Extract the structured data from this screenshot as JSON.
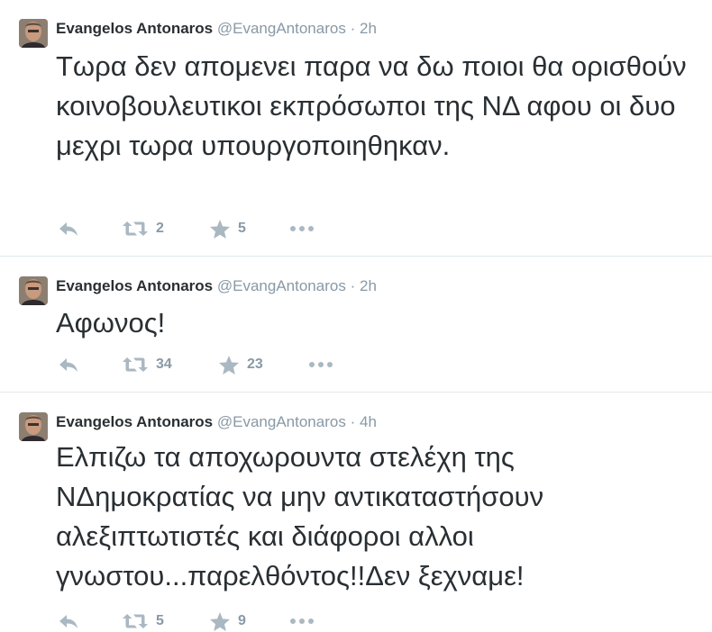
{
  "tweets": [
    {
      "name": "Evangelos Antonaros",
      "handle": "@EvangAntonaros",
      "dot": "·",
      "time": "2h",
      "text": "Τωρα δεν απομενει παρα να δω ποιοι θα ορισθούν κοινοβουλευτικοι εκπρόσωποι της ΝΔ αφου οι δυο μεχρι τωρα υπουργοποιηθηκαν.",
      "retweets": "2",
      "favorites": "5"
    },
    {
      "name": "Evangelos Antonaros",
      "handle": "@EvangAntonaros",
      "dot": "·",
      "time": "2h",
      "text": "Αφωνος!",
      "retweets": "34",
      "favorites": "23"
    },
    {
      "name": "Evangelos Antonaros",
      "handle": "@EvangAntonaros",
      "dot": "·",
      "time": "4h",
      "text": "Ελπιζω τα αποχωρουντα στελέχη της ΝΔημοκρατίας να μην αντικαταστήσουν αλεξιπτωτιστές και διάφοροι αλλοι γνωστου...παρελθόντος!!Δεν ξεχναμε!",
      "retweets": "5",
      "favorites": "9"
    }
  ],
  "icons": {
    "reply": "reply-icon",
    "retweet": "retweet-icon",
    "favorite": "star-icon",
    "more": "more-icon"
  },
  "colors": {
    "text": "#292f33",
    "muted": "#8899a6",
    "icon": "#aab8c2",
    "divider": "#e1e8ed"
  }
}
